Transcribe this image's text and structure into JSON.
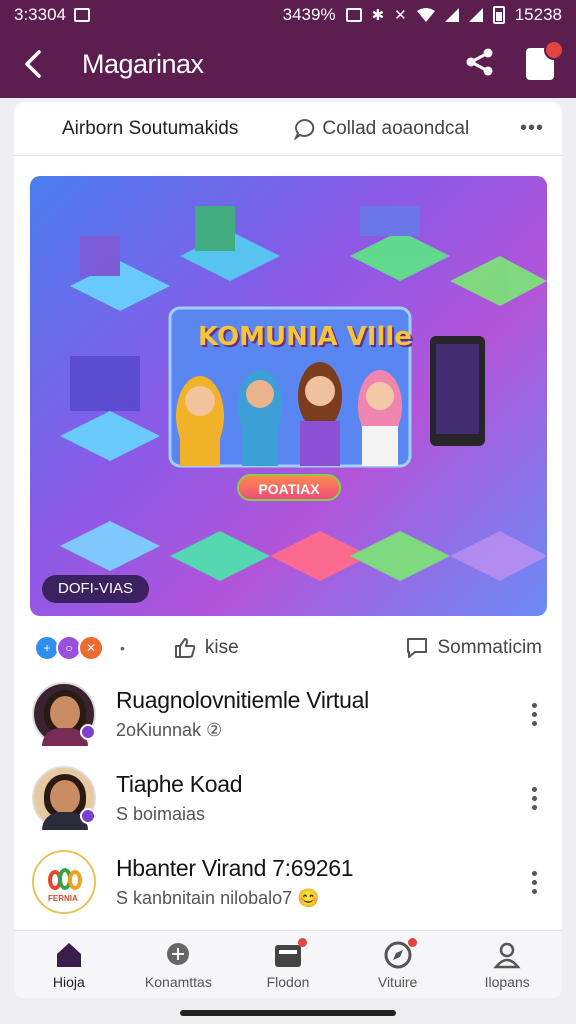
{
  "status_bar": {
    "time": "3:3304",
    "battery_percent": "3439%",
    "clock_right": "15238"
  },
  "app_bar": {
    "title": "Magarinax"
  },
  "post": {
    "author": "Airborn Soutumakids",
    "collab_label": "Collad aoaondcal",
    "hero": {
      "title": "KOMUNIA VIlle",
      "button_label": "POATIAX",
      "badge_label": "DOFI-VIAS"
    },
    "like_label": "kise",
    "comment_label": "Sommaticim"
  },
  "list": [
    {
      "title": "Ruagnolovnitiemle Virtual",
      "subtitle": "2oKiunnak ②"
    },
    {
      "title": "Tiaphe Koad",
      "subtitle": "S boimaias"
    },
    {
      "title": "Hbanter Virand 7:69261",
      "subtitle": "S kanbnitain nilobalo7 😊"
    }
  ],
  "logo_text": "FERNIA",
  "bottom_nav": [
    {
      "label": "Hioja",
      "icon": "home-icon",
      "active": true
    },
    {
      "label": "Konamttas",
      "icon": "chat-icon",
      "active": false
    },
    {
      "label": "Flodon",
      "icon": "inbox-icon",
      "active": false
    },
    {
      "label": "Vituire",
      "icon": "compass-icon",
      "active": false
    },
    {
      "label": "Ilopans",
      "icon": "profile-icon",
      "active": false
    }
  ],
  "colors": {
    "brand": "#5c1d4f",
    "notification": "#e2453f"
  }
}
